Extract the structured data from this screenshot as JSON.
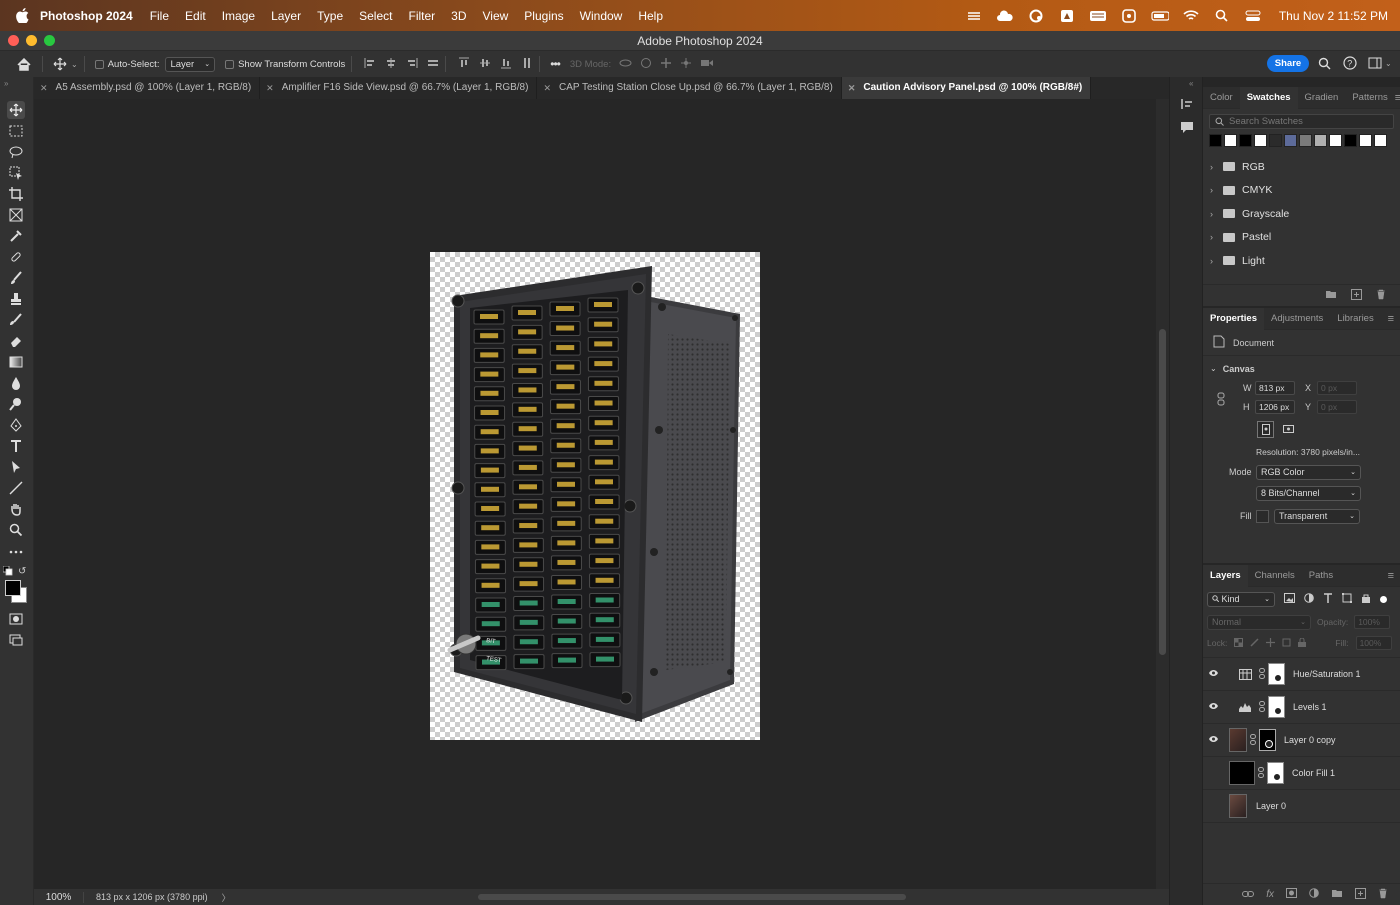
{
  "menubar": {
    "app_name": "Photoshop 2024",
    "items": [
      "File",
      "Edit",
      "Image",
      "Layer",
      "Type",
      "Select",
      "Filter",
      "3D",
      "View",
      "Plugins",
      "Window",
      "Help"
    ],
    "clock": "Thu Nov 2  11:52 PM"
  },
  "window": {
    "title": "Adobe Photoshop 2024"
  },
  "options": {
    "auto_select_label": "Auto-Select:",
    "auto_select_value": "Layer",
    "show_transform_label": "Show Transform Controls",
    "mode_3d_label": "3D Mode:",
    "share_label": "Share"
  },
  "tabs": [
    {
      "label": "A5 Assembly.psd @ 100% (Layer 1, RGB/8)"
    },
    {
      "label": "Amplifier F16 Side View.psd @ 66.7% (Layer 1, RGB/8)"
    },
    {
      "label": "CAP Testing Station Close Up.psd @ 66.7% (Layer 1, RGB/8)"
    },
    {
      "label": "Caution Advisory Panel.psd @ 100% (RGB/8#)"
    }
  ],
  "status": {
    "zoom": "100%",
    "dimensions": "813 px x 1206 px (3780 ppi)",
    "arrow": "〉"
  },
  "swatches": {
    "tabs": [
      "Color",
      "Swatches",
      "Gradien",
      "Patterns"
    ],
    "active_tab": "Swatches",
    "search_placeholder": "Search Swatches",
    "colors": [
      "#000000",
      "#ffffff",
      "#000000",
      "#ffffff",
      "#2b2b2b",
      "#5d6b9a",
      "#7a7a7a",
      "#b0b0b0",
      "#ffffff",
      "#000000",
      "#ffffff",
      "#ffffff"
    ],
    "groups": [
      "RGB",
      "CMYK",
      "Grayscale",
      "Pastel",
      "Light"
    ]
  },
  "properties": {
    "tabs": [
      "Properties",
      "Adjustments",
      "Libraries"
    ],
    "active_tab": "Properties",
    "doc_label": "Document",
    "canvas_label": "Canvas",
    "w_label": "W",
    "w_value": "813 px",
    "h_label": "H",
    "h_value": "1206 px",
    "x_label": "X",
    "x_value": "0 px",
    "y_label": "Y",
    "y_value": "0 px",
    "resolution": "Resolution: 3780 pixels/in...",
    "mode_label": "Mode",
    "mode_value": "RGB Color",
    "bits_value": "8 Bits/Channel",
    "fill_label": "Fill",
    "fill_value": "Transparent"
  },
  "layers_panel": {
    "tabs": [
      "Layers",
      "Channels",
      "Paths"
    ],
    "active_tab": "Layers",
    "filter_value": "Kind",
    "blend_value": "Normal",
    "opacity_label": "Opacity:",
    "opacity_value": "100%",
    "lock_label": "Lock:",
    "fill_label": "Fill:",
    "fill_value": "100%",
    "layers": [
      {
        "name": "Hue/Saturation 1",
        "visible": true
      },
      {
        "name": "Levels 1",
        "visible": true
      },
      {
        "name": "Layer 0 copy",
        "visible": true
      },
      {
        "name": "Color Fill 1",
        "visible": false
      },
      {
        "name": "Layer 0",
        "visible": false
      }
    ]
  },
  "colors": {
    "share": "#1473e6",
    "close": "#ff5f57",
    "minimize": "#febc2e",
    "zoom": "#28c840"
  }
}
